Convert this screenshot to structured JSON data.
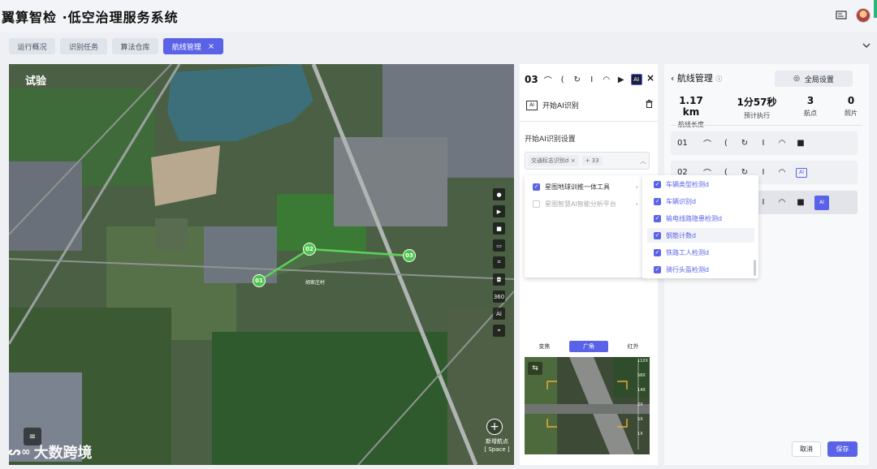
{
  "app": {
    "title": "翼算智检 ·低空治理服务系统"
  },
  "tabs": [
    {
      "label": "运行概况"
    },
    {
      "label": "识别任务"
    },
    {
      "label": "算法仓库"
    },
    {
      "label": "航线管理",
      "active": true,
      "close": "×"
    }
  ],
  "map": {
    "label": "试验",
    "tools": [
      "camera-icon",
      "video-icon",
      "record-icon",
      "panorama-icon",
      "frame-icon",
      "photo-icon",
      "360",
      "ai-icon",
      "scan-icon"
    ],
    "tool_360": "360",
    "add_waypoint": {
      "label": "新增航点",
      "hint": "[ Space ]",
      "icon": "+"
    },
    "waypoints": [
      {
        "label": "01"
      },
      {
        "label": "02"
      },
      {
        "label": "03"
      }
    ],
    "place_label": "胡家庄村"
  },
  "mid_panel": {
    "waypoint": "03",
    "close": "×",
    "ai_badge": "AI",
    "ai_start": "开始AI识别",
    "ai_settings_label": "开始AI识别设置",
    "select_chip": "交通标志识别d",
    "select_chip_close": "×",
    "select_more": "+ 33",
    "dropdown_left": [
      {
        "label": "星图地球训推一体工具",
        "checked": true
      },
      {
        "label": "星图智慧AI智能分析平台",
        "checked": false
      }
    ],
    "dropdown_right": [
      "车辆类型检测d",
      "车辆识别d",
      "输电线路隐患检测d",
      "钢筋计数d",
      "铁路工人检测d",
      "骑行头盔检测d"
    ],
    "camera_tabs": [
      "变焦",
      "广角",
      "红外"
    ],
    "camera_active": "广角",
    "zoom_scale": [
      "112X",
      "56X",
      "14X",
      "2X",
      "5X",
      "1X"
    ]
  },
  "right_panel": {
    "title": "航线管理",
    "info_icon": "ⓘ",
    "global_settings": "全局设置",
    "stats": [
      {
        "value": "1.17 km",
        "label": "航线长度"
      },
      {
        "value": "1分57秒",
        "label": "预计执行"
      },
      {
        "value": "3",
        "label": "航点"
      },
      {
        "value": "0",
        "label": "照片"
      }
    ],
    "waypoint_rows": [
      "01",
      "02",
      "03"
    ],
    "ai_badge": "AI",
    "cancel": "取消",
    "save": "保存"
  },
  "watermark": "大数跨境",
  "colors": {
    "accent": "#5a63e8",
    "route": "#5fd35a"
  }
}
